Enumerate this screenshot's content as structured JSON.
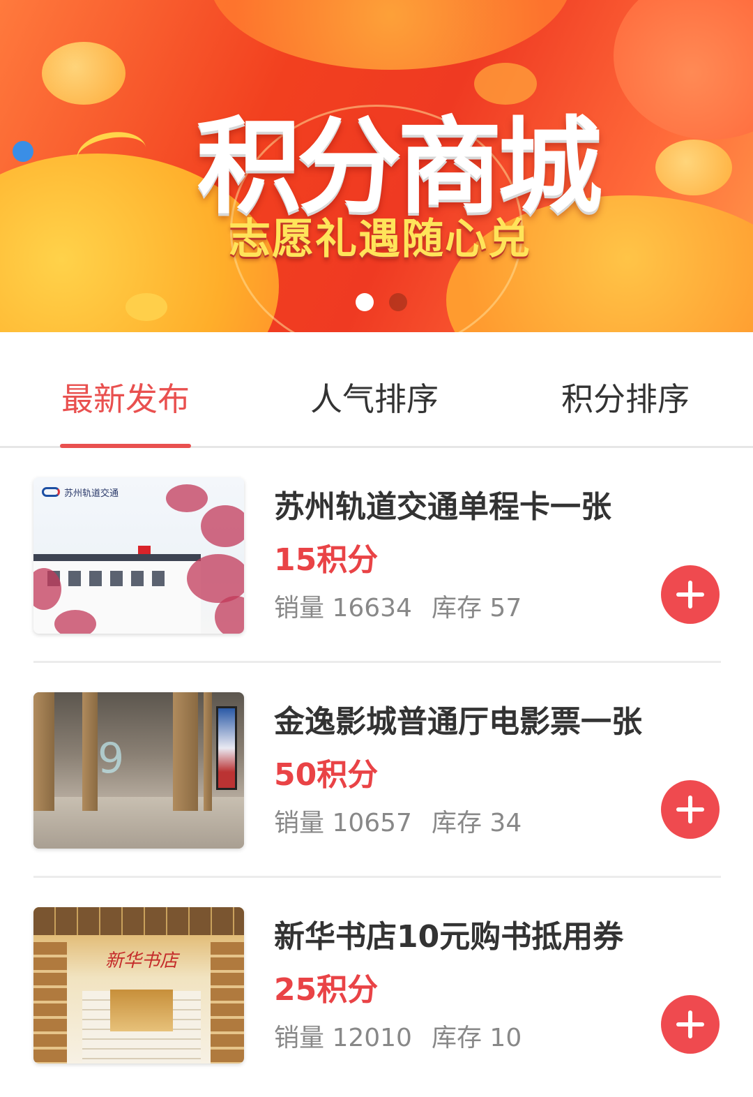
{
  "banner": {
    "title": "积分商城",
    "subtitle": "志愿礼遇随心兑",
    "slide_count": 2,
    "active_slide": 1
  },
  "tabs": [
    {
      "label": "最新发布",
      "active": true
    },
    {
      "label": "人气排序",
      "active": false
    },
    {
      "label": "积分排序",
      "active": false
    }
  ],
  "colors": {
    "accent": "#e9504f",
    "price": "#e94346",
    "add_button": "#ef4a4f"
  },
  "products": [
    {
      "name": "苏州轨道交通单程卡一张",
      "points": "15积分",
      "sales_label": "销量 16634",
      "stock_label": "库存 57",
      "thumb_logo_text": "苏州轨道交通"
    },
    {
      "name": "金逸影城普通厅电影票一张",
      "points": "50积分",
      "sales_label": "销量 10657",
      "stock_label": "库存 34"
    },
    {
      "name": "新华书店10元购书抵用券",
      "points": "25积分",
      "sales_label": "销量 12010",
      "stock_label": "库存 10",
      "thumb_sign_text": "新华书店"
    }
  ],
  "icons": {
    "add": "plus-icon"
  }
}
